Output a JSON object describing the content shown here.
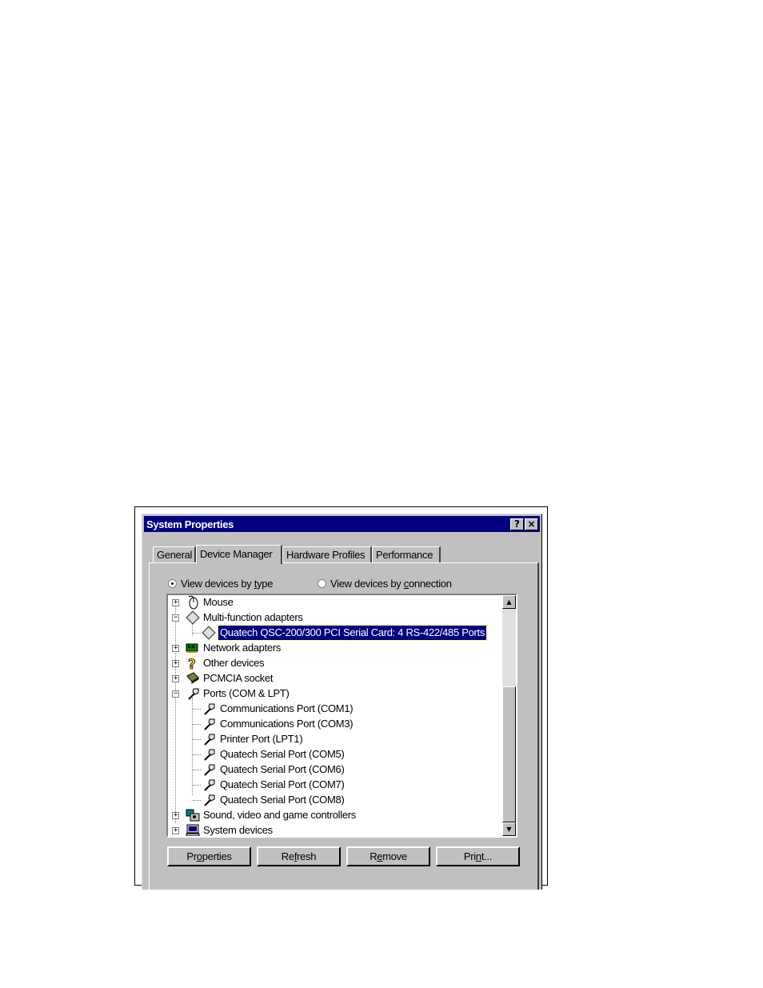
{
  "window": {
    "title": "System Properties",
    "help_btn": "?",
    "close_btn": "×"
  },
  "tabs": [
    {
      "label": "General",
      "active": false
    },
    {
      "label": "Device Manager",
      "active": true
    },
    {
      "label": "Hardware Profiles",
      "active": false
    },
    {
      "label": "Performance",
      "active": false
    }
  ],
  "view_options": {
    "by_type": {
      "pre": "View devices by ",
      "accel": "t",
      "post": "ype",
      "selected": true
    },
    "by_connection": {
      "pre": "View devices by ",
      "accel": "c",
      "post": "onnection",
      "selected": false
    }
  },
  "tree": {
    "items": [
      {
        "label": "Mouse",
        "expander": "+",
        "icon": "mouse-icon"
      },
      {
        "label": "Multi-function adapters",
        "expander": "−",
        "icon": "multi-function-adapter-icon"
      },
      {
        "label": "Quatech QSC-200/300 PCI Serial Card: 4 RS-422/485 Ports",
        "icon": "serial-card-icon",
        "selected": true
      },
      {
        "label": "Network adapters",
        "expander": "+",
        "icon": "network-adapter-icon"
      },
      {
        "label": "Other devices",
        "expander": "+",
        "icon": "question-mark-icon"
      },
      {
        "label": "PCMCIA socket",
        "expander": "+",
        "icon": "pcmcia-card-icon"
      },
      {
        "label": "Ports (COM & LPT)",
        "expander": "−",
        "icon": "port-connector-icon"
      },
      {
        "label": "Communications Port (COM1)",
        "icon": "port-connector-icon"
      },
      {
        "label": "Communications Port (COM3)",
        "icon": "port-connector-icon"
      },
      {
        "label": "Printer Port (LPT1)",
        "icon": "port-connector-icon"
      },
      {
        "label": "Quatech Serial Port (COM5)",
        "icon": "port-connector-icon"
      },
      {
        "label": "Quatech Serial Port (COM6)",
        "icon": "port-connector-icon"
      },
      {
        "label": "Quatech Serial Port (COM7)",
        "icon": "port-connector-icon"
      },
      {
        "label": "Quatech Serial Port (COM8)",
        "icon": "port-connector-icon"
      },
      {
        "label": "Sound, video and game controllers",
        "expander": "+",
        "icon": "sound-video-icon"
      },
      {
        "label": "System devices",
        "expander": "+",
        "icon": "computer-icon"
      }
    ]
  },
  "buttons": {
    "properties": {
      "pre": "Pr",
      "accel": "o",
      "post": "perties"
    },
    "refresh": {
      "pre": "Re",
      "accel": "f",
      "post": "resh"
    },
    "remove": {
      "pre": "R",
      "accel": "e",
      "post": "move"
    },
    "print": {
      "pre": "Pri",
      "accel": "n",
      "post": "t..."
    }
  },
  "scrollbar": {
    "up": "▲",
    "down": "▼"
  }
}
